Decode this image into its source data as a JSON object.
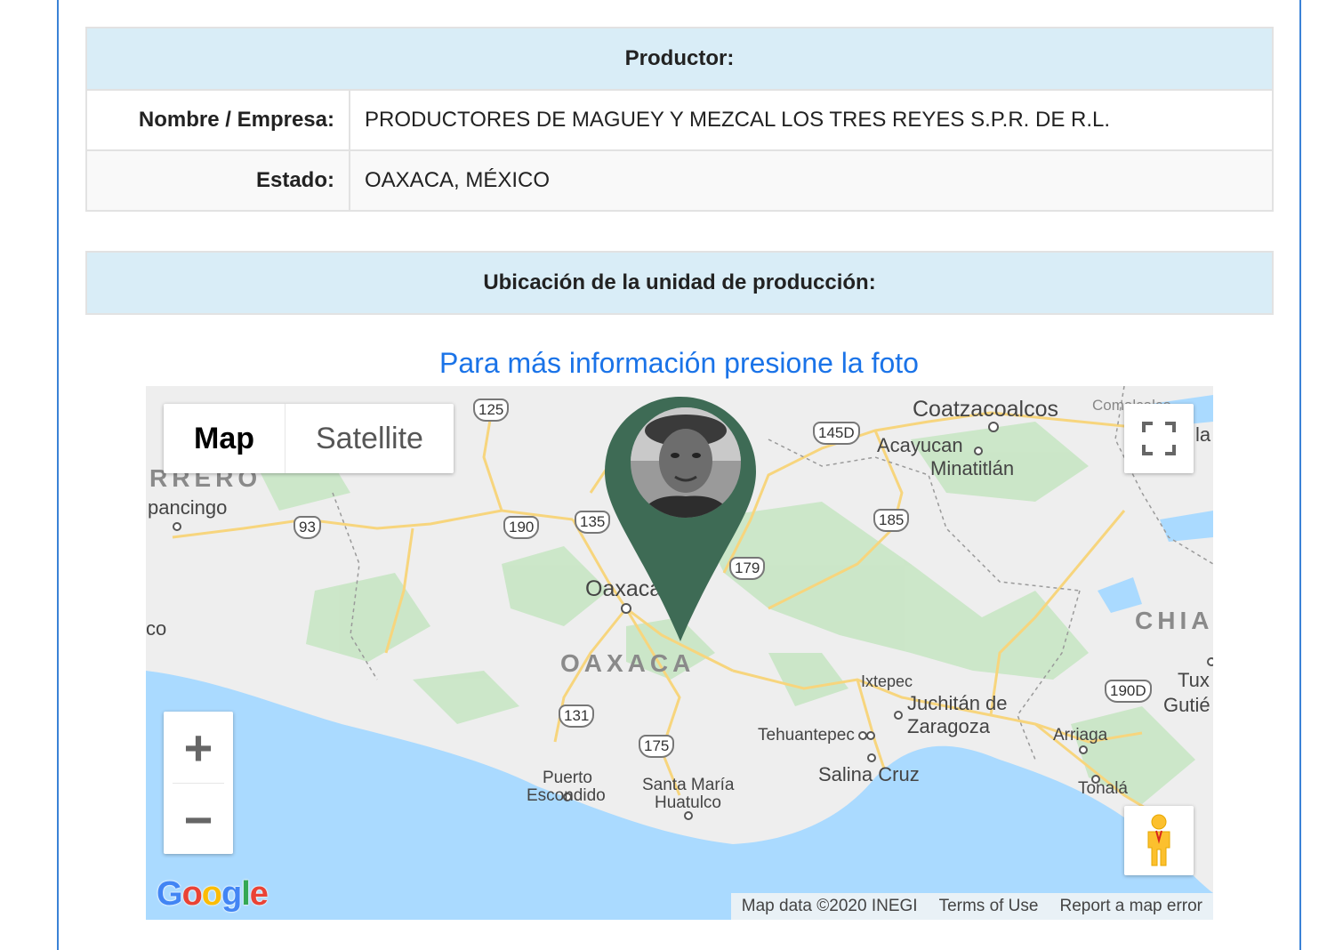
{
  "producer_table": {
    "header": "Productor:",
    "rows": [
      {
        "label": "Nombre / Empresa:",
        "value": "PRODUCTORES DE MAGUEY Y MEZCAL LOS TRES REYES S.P.R. DE R.L."
      },
      {
        "label": "Estado:",
        "value": "OAXACA, MÉXICO"
      }
    ]
  },
  "location_table": {
    "header": "Ubicación de la unidad de producción:"
  },
  "map": {
    "link_text": "Para más información presione la foto",
    "type_control": {
      "map": "Map",
      "satellite": "Satellite",
      "selected": "Map"
    },
    "zoom_in": "+",
    "zoom_out": "−",
    "google_logo": [
      "G",
      "o",
      "o",
      "g",
      "l",
      "e"
    ],
    "google_colors": [
      "#4285F4",
      "#EA4335",
      "#FBBC05",
      "#4285F4",
      "#34A853",
      "#EA4335"
    ],
    "attribution": {
      "data": "Map data ©2020 INEGI",
      "terms": "Terms of Use",
      "report": "Report a map error"
    },
    "places": [
      "Coatzacoalcos",
      "Acayucan",
      "Minatitlán",
      "Oaxaca",
      "Ixtepec",
      "Juchitán de",
      "Zaragoza",
      "Tehuantepec",
      "Salina Cruz",
      "Arriaga",
      "Tonalá",
      "Puerto",
      "Escondido",
      "Santa María",
      "Huatulco",
      "pancingo",
      "co",
      "Comalcalco",
      "la",
      "Tux",
      "Gutié"
    ],
    "states": [
      "OAXACA",
      "RRERO",
      "CHIA"
    ],
    "highways": [
      "125",
      "145D",
      "93",
      "190",
      "135",
      "185",
      "179",
      "131",
      "175",
      "190D"
    ],
    "marker_color": "#3e6b55",
    "water_color": "#aadaff",
    "land_color": "#eeeeee",
    "forest_color": "#c5e8c5"
  }
}
